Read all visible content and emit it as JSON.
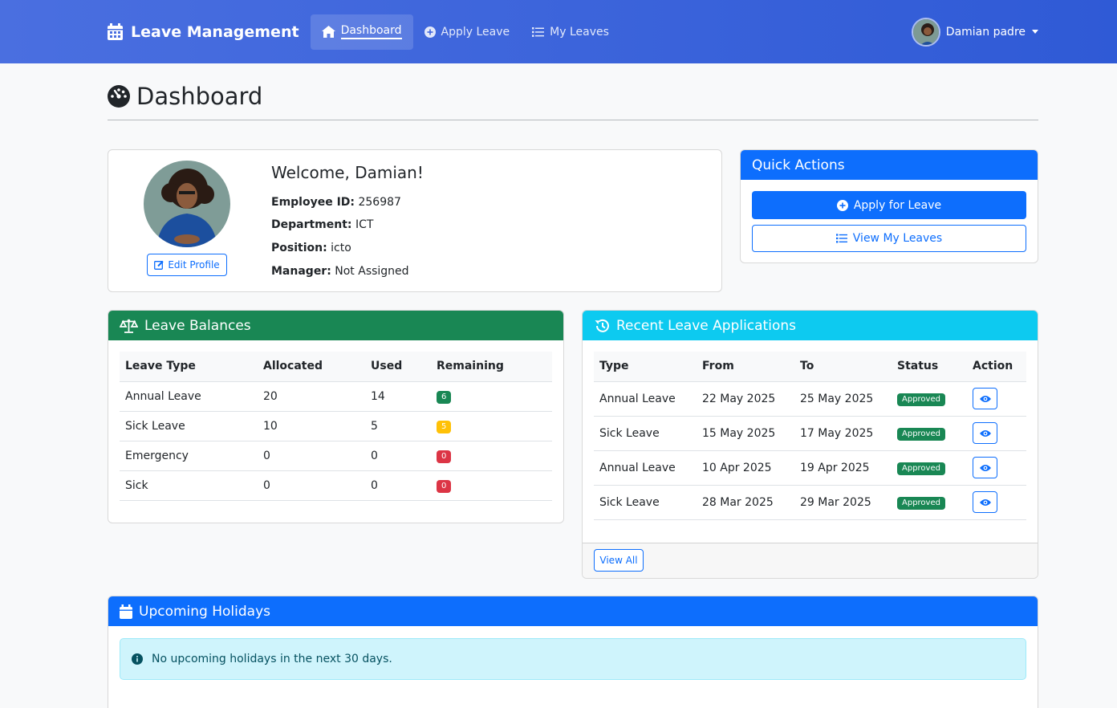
{
  "nav": {
    "brand": "Leave Management",
    "links": [
      "Dashboard",
      "Apply Leave",
      "My Leaves"
    ],
    "user": "Damian padre"
  },
  "page": {
    "title": "Dashboard"
  },
  "profile": {
    "welcome": "Welcome, Damian!",
    "edit_label": "Edit Profile",
    "fields": [
      {
        "label": "Employee ID:",
        "value": "256987"
      },
      {
        "label": "Department:",
        "value": "ICT"
      },
      {
        "label": "Position:",
        "value": "icto"
      },
      {
        "label": "Manager:",
        "value": "Not Assigned"
      }
    ]
  },
  "quick": {
    "title": "Quick Actions",
    "apply": "Apply for Leave",
    "view": "View My Leaves"
  },
  "balances": {
    "title": "Leave Balances",
    "headers": [
      "Leave Type",
      "Allocated",
      "Used",
      "Remaining"
    ],
    "rows": [
      {
        "type": "Annual Leave",
        "allocated": "20",
        "used": "14",
        "remaining": "6"
      },
      {
        "type": "Sick Leave",
        "allocated": "10",
        "used": "5",
        "remaining": "5"
      },
      {
        "type": "Emergency",
        "allocated": "0",
        "used": "0",
        "remaining": "0"
      },
      {
        "type": "Sick",
        "allocated": "0",
        "used": "0",
        "remaining": "0"
      }
    ]
  },
  "recent": {
    "title": "Recent Leave Applications",
    "headers": [
      "Type",
      "From",
      "To",
      "Status",
      "Action"
    ],
    "rows": [
      {
        "type": "Annual Leave",
        "from": "22 May 2025",
        "to": "25 May 2025",
        "status": "Approved"
      },
      {
        "type": "Sick Leave",
        "from": "15 May 2025",
        "to": "17 May 2025",
        "status": "Approved"
      },
      {
        "type": "Annual Leave",
        "from": "10 Apr 2025",
        "to": "19 Apr 2025",
        "status": "Approved"
      },
      {
        "type": "Sick Leave",
        "from": "28 Mar 2025",
        "to": "29 Mar 2025",
        "status": "Approved"
      }
    ],
    "view_all": "View All"
  },
  "holidays": {
    "title": "Upcoming Holidays",
    "message": "No upcoming holidays in the next 30 days."
  },
  "colors": {
    "nav_gradient_start": "#4a6fe0",
    "nav_gradient_end": "#2f5ad6",
    "primary": "#0d6efd",
    "success": "#198754",
    "info": "#0dcaf0",
    "warning": "#ffc107",
    "danger": "#dc3545"
  },
  "icons": [
    "calendar-icon",
    "home-icon",
    "plus-circle-icon",
    "list-icon",
    "dashboard-gauge-icon",
    "edit-icon",
    "balance-scale-icon",
    "history-icon",
    "eye-icon",
    "calendar-icon",
    "info-circle-icon"
  ]
}
